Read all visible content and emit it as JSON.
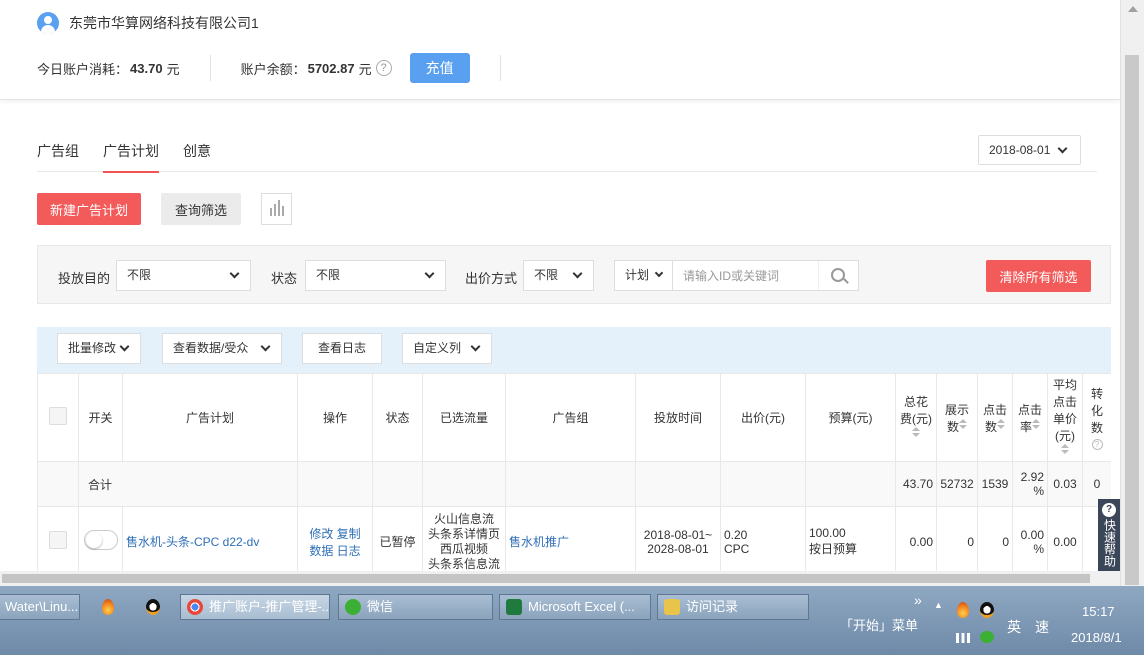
{
  "account": {
    "company_name": "东莞市华算网络科技有限公司1",
    "today_cost_label": "今日账户消耗：",
    "today_cost_value": "43.70",
    "today_cost_unit": "元",
    "balance_label": "账户余额：",
    "balance_value": "5702.87",
    "balance_unit": "元",
    "help_glyph": "?",
    "recharge_label": "充值"
  },
  "tabs": [
    {
      "label": "广告组",
      "active": false
    },
    {
      "label": "广告计划",
      "active": true
    },
    {
      "label": "创意",
      "active": false
    }
  ],
  "date_select": "2018-08-01",
  "actions": {
    "new_plan": "新建广告计划",
    "query_filter": "查询筛选"
  },
  "filters": {
    "purpose_label": "投放目的",
    "purpose_value": "不限",
    "status_label": "状态",
    "status_value": "不限",
    "bid_label": "出价方式",
    "bid_value": "不限",
    "search_type": "计划",
    "search_placeholder": "请输入ID或关键词",
    "clear_all": "清除所有筛选"
  },
  "toolbar": {
    "batch_edit": "批量修改",
    "view_data": "查看数据/受众",
    "view_log": "查看日志",
    "custom_columns": "自定义列"
  },
  "table": {
    "headers": {
      "switch": "开关",
      "plan": "广告计划",
      "ops": "操作",
      "status": "状态",
      "traffic": "已选流量",
      "group": "广告组",
      "time": "投放时间",
      "bid": "出价(元)",
      "budget": "预算(元)",
      "total_cost": "总花费(元)",
      "impressions": "展示数",
      "clicks": "点击数",
      "ctr": "点击率",
      "avg_cpc": "平均点击单价(元)",
      "conversions": "转化数"
    },
    "total": {
      "label": "合计",
      "total_cost": "43.70",
      "impressions": "52732",
      "clicks": "1539",
      "ctr": "2.92 %",
      "avg_cpc": "0.03",
      "conversions": "0"
    },
    "rows": [
      {
        "plan_name": "售水机-头条-CPC d22-dv",
        "op_edit": "修改",
        "op_copy": "复制",
        "op_data": "数据",
        "op_log": "日志",
        "status": "已暂停",
        "traffic": [
          "火山信息流",
          "头条系详情页",
          "西瓜视频",
          "头条系信息流"
        ],
        "group": "售水机推广",
        "time_start": "2018-08-01~",
        "time_end": "2028-08-01",
        "bid_value": "0.20",
        "bid_type": "CPC",
        "budget_value": "100.00",
        "budget_type": "按日预算",
        "total_cost": "0.00",
        "impressions": "0",
        "clicks": "0",
        "ctr": "0.00 %",
        "avg_cpc": "0.00"
      }
    ]
  },
  "quick_help": {
    "glyph": "?",
    "label": "快速帮助"
  },
  "taskbar": {
    "items": [
      {
        "label": "Water\\Linu...",
        "icon_color": "#4a6a8a"
      },
      {
        "label": "推广账户-推广管理-...",
        "icon_color": "#e8483b"
      },
      {
        "label": "微信",
        "icon_color": "#3cb034"
      },
      {
        "label": "Microsoft Excel (...",
        "icon_color": "#1f7a3e"
      },
      {
        "label": "访问记录",
        "icon_color": "#e8c44a"
      }
    ],
    "start_menu": "「开始」菜单",
    "expand": "»",
    "ime_lang": "英",
    "ime_speed": "速",
    "time": "15:17",
    "date": "2018/8/1"
  },
  "colors": {
    "primary_red": "#f35a5a",
    "primary_blue": "#5aa0f0",
    "link": "#2f6fb7"
  }
}
